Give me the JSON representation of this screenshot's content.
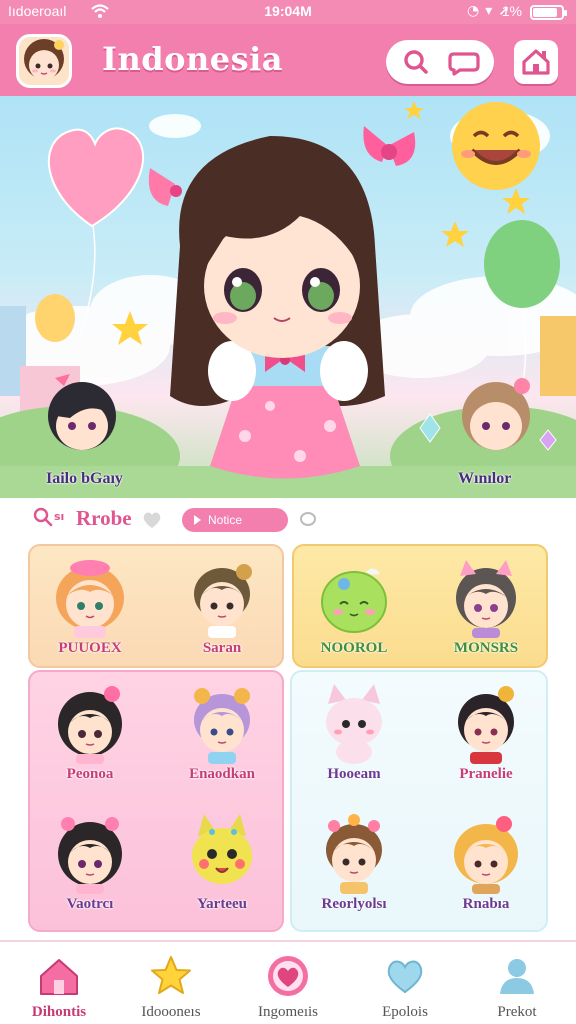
{
  "status_bar": {
    "carrier": "Iıdoeroaıl",
    "time": "19:04M",
    "battery_percent_text": "1%",
    "battery_level": 0.85
  },
  "header": {
    "title": "Indonesia"
  },
  "hero": {
    "caption_left": "Iailo bGaıy",
    "caption_right": "Wınılor"
  },
  "filter_row": {
    "prefix": "sı",
    "section_title": "Rrobe",
    "chip_label": "Notice"
  },
  "top_cards": [
    {
      "name": "PUUOEX"
    },
    {
      "name": "Saran"
    },
    {
      "name": "NOOROL"
    },
    {
      "name": "MONSRS"
    }
  ],
  "grid_cards": [
    {
      "name": "Peonoa"
    },
    {
      "name": "Enaodkan"
    },
    {
      "name": "Hooeam"
    },
    {
      "name": "Pranelie"
    },
    {
      "name": "Vaotrcı"
    },
    {
      "name": "Yarteeu"
    },
    {
      "name": "Reorlyolsı"
    },
    {
      "name": "Rnabıa"
    }
  ],
  "bottom_nav": [
    {
      "label": "Dihontis",
      "icon": "home-icon",
      "active": true
    },
    {
      "label": "Idoooneıs",
      "icon": "star-icon",
      "active": false
    },
    {
      "label": "Ingomeıis",
      "icon": "heart-icon",
      "active": false
    },
    {
      "label": "Epolois",
      "icon": "heart-outline-icon",
      "active": false
    },
    {
      "label": "Prekot",
      "icon": "profile-icon",
      "active": false
    }
  ],
  "colors": {
    "primary_pink": "#f27fae",
    "accent_magenta": "#e0558f",
    "peach_panel": "#fde7c3",
    "yellow_panel": "#fde9a6",
    "pink_panel": "#ffd3e4",
    "mint_panel": "#f3fbfd"
  }
}
